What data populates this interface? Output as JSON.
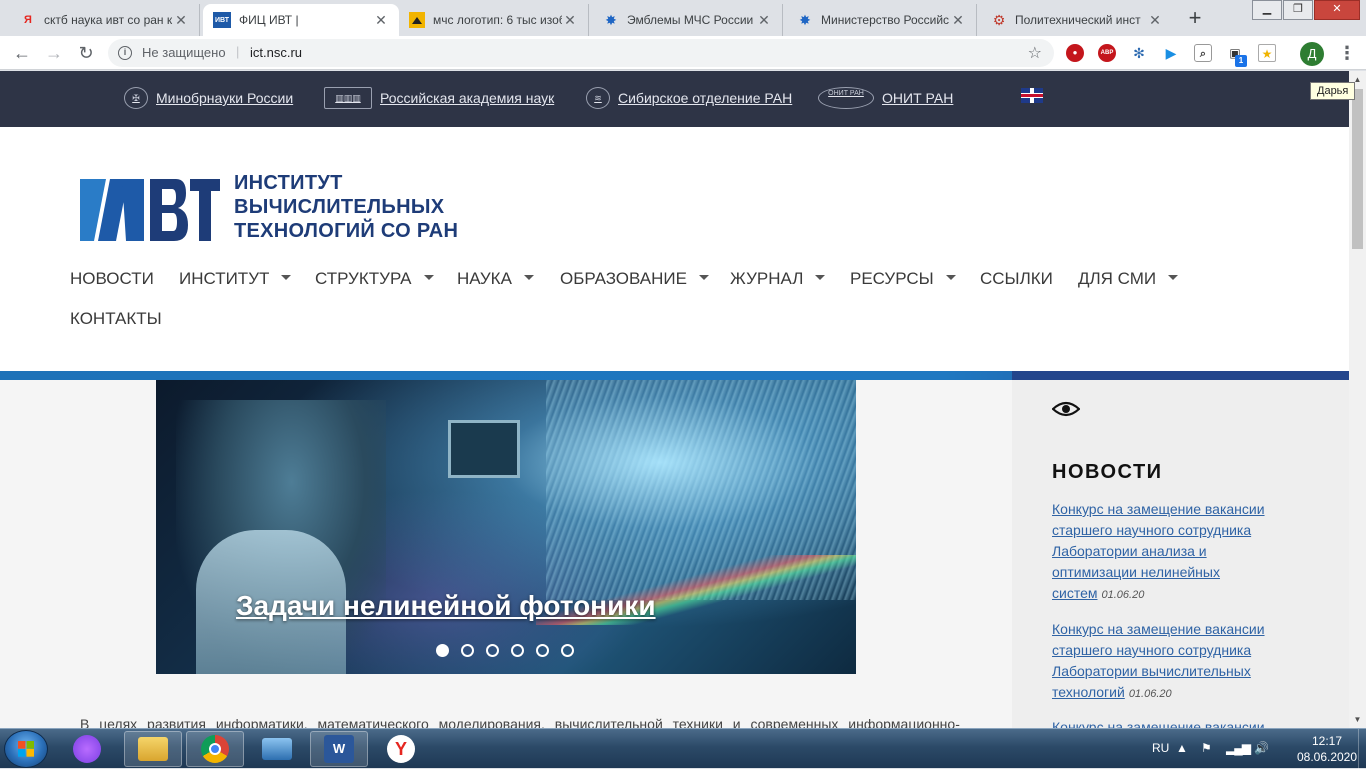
{
  "browser": {
    "tabs": [
      {
        "title": "сктб наука ивт со ран к",
        "favicon": "Я"
      },
      {
        "title": "ФИЦ ИВТ |",
        "favicon": "ИВТ",
        "active": true
      },
      {
        "title": "мчс логотип: 6 тыс изоб",
        "favicon": "image-icon"
      },
      {
        "title": "Эмблемы МЧС России",
        "favicon": "emblem-icon"
      },
      {
        "title": "Министерство Российс",
        "favicon": "emblem-icon"
      },
      {
        "title": "Политехнический инст",
        "favicon": "gear-icon"
      }
    ],
    "security_label": "Не защищено",
    "url": "ict.nsc.ru",
    "profile_initial": "Д",
    "tooltip": "Дарья",
    "extensions": [
      "ublock-icon",
      "adblock-icon",
      "shield-icon",
      "play-icon",
      "search-icon",
      "cube-icon",
      "badge-icon"
    ],
    "extension_badge": "1",
    "abp_label": "ABP"
  },
  "topbar": {
    "links": [
      {
        "label": "Минобрнауки России",
        "icon": "coat-of-arms-icon"
      },
      {
        "label": "Российская академия наук",
        "icon": "academy-building-icon"
      },
      {
        "label": "Сибирское отделение РАН",
        "icon": "sb-ras-icon"
      },
      {
        "label": "ОНИТ РАН",
        "icon": "onit-logo-icon",
        "emblem": "ОНИТ РАН"
      }
    ],
    "language_flag": "uk-flag-icon"
  },
  "header": {
    "logo_mark": "ИВТ",
    "logo_lines": [
      "ИНСТИТУТ",
      "ВЫЧИСЛИТЕЛЬНЫХ",
      "ТЕХНОЛОГИЙ СО РАН"
    ],
    "nav": [
      {
        "label": "НОВОСТИ",
        "dropdown": false
      },
      {
        "label": "ИНСТИТУТ",
        "dropdown": true
      },
      {
        "label": "СТРУКТУРА",
        "dropdown": true
      },
      {
        "label": "НАУКА",
        "dropdown": true
      },
      {
        "label": "ОБРАЗОВАНИЕ",
        "dropdown": true
      },
      {
        "label": "ЖУРНАЛ",
        "dropdown": true
      },
      {
        "label": "РЕСУРСЫ",
        "dropdown": true
      },
      {
        "label": "ССЫЛКИ",
        "dropdown": false
      },
      {
        "label": "ДЛЯ СМИ",
        "dropdown": true
      },
      {
        "label": "КОНТАКТЫ",
        "dropdown": false
      }
    ]
  },
  "slider": {
    "caption": "Задачи нелинейной фотоники",
    "slide_count": 6,
    "active_index": 0
  },
  "main": {
    "intro_text": "В целях развития информатики, математического моделирования, вычислительной техники и современных информационно-"
  },
  "sidebar": {
    "heading": "НОВОСТИ",
    "items": [
      {
        "title": "Конкурс на замещение вакансии старшего научного сотрудника Лаборатории анализа и оптимизации нелинейных систем",
        "date": "01.06.20"
      },
      {
        "title": "Конкурс на замещение вакансии старшего научного сотрудника Лаборатории вычислительных технологий",
        "date": "01.06.20"
      },
      {
        "title": "Конкурс на замещение вакансии",
        "date": ""
      }
    ]
  },
  "taskbar": {
    "apps": [
      {
        "name": "alice-icon",
        "label": ""
      },
      {
        "name": "file-explorer-icon",
        "label": ""
      },
      {
        "name": "chrome-icon",
        "label": ""
      },
      {
        "name": "network-app-icon",
        "label": ""
      },
      {
        "name": "word-icon",
        "label": "W"
      },
      {
        "name": "yandex-browser-icon",
        "label": "Y"
      }
    ],
    "language": "RU",
    "time": "12:17",
    "date": "08.06.2020"
  },
  "colors": {
    "topbar_bg": "#2e3446",
    "brand_blue": "#1e3c78",
    "accent_line": "#1e72b8",
    "link": "#2f63a5"
  }
}
